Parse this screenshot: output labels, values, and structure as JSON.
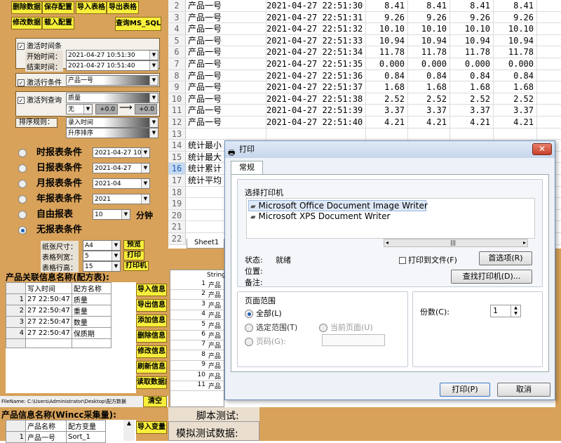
{
  "toolbar": {
    "delete_data": "删除数据",
    "save_config": "保存配置",
    "import_table": "导入表格",
    "export_table": "导出表格",
    "modify_data": "修改数据",
    "load_config": "载入配置",
    "query_ms_sql": "查询MS_SQL"
  },
  "time_filter": {
    "activate_label": "激活时间条",
    "start_label": "开始时间：",
    "start_value": "2021-04-27 10:51:30",
    "end_label": "结束时间：",
    "end_value": "2021-04-27 10:51:40"
  },
  "row_filter": {
    "label": "激活行条件",
    "value": "产品一号"
  },
  "col_query": {
    "label": "激活列查询",
    "field": "质量",
    "op": "无",
    "min": "+0.0",
    "max": "+0.0"
  },
  "sort": {
    "label": "排序规则：",
    "field": "录入时间",
    "order": "升序排序"
  },
  "reports": {
    "hour": {
      "label": "时报表条件",
      "value": "2021-04-27 10"
    },
    "day": {
      "label": "日报表条件",
      "value": "2021-04-27"
    },
    "month": {
      "label": "月报表条件",
      "value": "2021-04"
    },
    "year": {
      "label": "年报表条件",
      "value": "2021"
    },
    "free": {
      "label": "自由报表",
      "value": "10",
      "unit": "分钟"
    },
    "none": {
      "label": "无报表条件"
    }
  },
  "print_settings": {
    "paper_label": "纸张尺寸：",
    "paper_value": "A4",
    "preview": "预览",
    "cols_label": "表格列宽：",
    "cols_value": "5",
    "print": "打印",
    "rows_label": "表格行高：",
    "rows_value": "15",
    "printer": "打印机"
  },
  "recipe": {
    "title": "产品关联信息名称(配方表):",
    "headers": [
      "写入时间",
      "配方名称"
    ],
    "rows": [
      [
        "1",
        "27 22:50:47",
        "质量"
      ],
      [
        "2",
        "27 22:50:47",
        "重量"
      ],
      [
        "3",
        "27 22:50:47",
        "数量"
      ],
      [
        "4",
        "27 22:50:47",
        "保质期"
      ]
    ],
    "buttons": [
      "导入信息",
      "导出信息",
      "添加信息",
      "删除信息",
      "修改信息",
      "刷新信息",
      "读取数据库"
    ]
  },
  "filename": {
    "text": "FileName: C:\\Users\\Administrator\\Desktop\\配方数据",
    "clear": "清空"
  },
  "wincc": {
    "title": "产品信息名称(Wincc采集量):",
    "headers": [
      "产品名称",
      "配方变量"
    ],
    "row": [
      "1",
      "产品一号",
      "Sort_1"
    ],
    "import_btn": "导入变量"
  },
  "sheet": {
    "rows": [
      [
        "2",
        "产品一号",
        "2021-04-27 22:51:30",
        "8.41",
        "8.41",
        "8.41",
        "8.41"
      ],
      [
        "3",
        "产品一号",
        "2021-04-27 22:51:31",
        "9.26",
        "9.26",
        "9.26",
        "9.26"
      ],
      [
        "4",
        "产品一号",
        "2021-04-27 22:51:32",
        "10.10",
        "10.10",
        "10.10",
        "10.10"
      ],
      [
        "5",
        "产品一号",
        "2021-04-27 22:51:33",
        "10.94",
        "10.94",
        "10.94",
        "10.94"
      ],
      [
        "6",
        "产品一号",
        "2021-04-27 22:51:34",
        "11.78",
        "11.78",
        "11.78",
        "11.78"
      ],
      [
        "7",
        "产品一号",
        "2021-04-27 22:51:35",
        "0.000",
        "0.000",
        "0.000",
        "0.000"
      ],
      [
        "8",
        "产品一号",
        "2021-04-27 22:51:36",
        "0.84",
        "0.84",
        "0.84",
        "0.84"
      ],
      [
        "9",
        "产品一号",
        "2021-04-27 22:51:37",
        "1.68",
        "1.68",
        "1.68",
        "1.68"
      ],
      [
        "10",
        "产品一号",
        "2021-04-27 22:51:38",
        "2.52",
        "2.52",
        "2.52",
        "2.52"
      ],
      [
        "11",
        "产品一号",
        "2021-04-27 22:51:39",
        "3.37",
        "3.37",
        "3.37",
        "3.37"
      ],
      [
        "12",
        "产品一号",
        "2021-04-27 22:51:40",
        "4.21",
        "4.21",
        "4.21",
        "4.21"
      ],
      [
        "13",
        "",
        "",
        "",
        "",
        "",
        ""
      ],
      [
        "14",
        "统计最小",
        "",
        "",
        "",
        "",
        ""
      ],
      [
        "15",
        "统计最大",
        "",
        "",
        "",
        "",
        ""
      ],
      [
        "16",
        "统计累计",
        "",
        "",
        "",
        "",
        ""
      ],
      [
        "17",
        "统计平均",
        "",
        "",
        "",
        "",
        ""
      ],
      [
        "18",
        "",
        "",
        "",
        "",
        "",
        ""
      ],
      [
        "19",
        "",
        "",
        "",
        "",
        "",
        ""
      ],
      [
        "20",
        "",
        "",
        "",
        "",
        "",
        ""
      ],
      [
        "21",
        "",
        "",
        "",
        "",
        "",
        ""
      ],
      [
        "22",
        "",
        "",
        "",
        "",
        "",
        ""
      ]
    ],
    "tab": "Sheet1"
  },
  "lower_sheet": {
    "header": "String",
    "rows": [
      "1",
      "2",
      "3",
      "4",
      "5",
      "6",
      "7",
      "8",
      "9",
      "10",
      "11"
    ],
    "cell": "产品"
  },
  "script": {
    "title": "脚本测试:",
    "sim": "模拟测试数据:"
  },
  "dialog": {
    "title": "打印",
    "tab": "常规",
    "select_printer": "选择打印机",
    "printers": [
      "Microsoft Office Document Image Writer",
      "Microsoft XPS Document Writer"
    ],
    "status_label": "状态:",
    "status_value": "就绪",
    "location_label": "位置:",
    "comment_label": "备注:",
    "print_to_file": "打印到文件(F)",
    "preferences": "首选项(R)",
    "find_printer": "查找打印机(D)...",
    "range_title": "页面范围",
    "range_all": "全部(L)",
    "range_sel": "选定范围(T)",
    "range_cur": "当前页面(U)",
    "range_pages": "页码(G):",
    "copies_label": "份数(C):",
    "copies_value": "1",
    "print_btn": "打印(P)",
    "cancel_btn": "取消"
  }
}
